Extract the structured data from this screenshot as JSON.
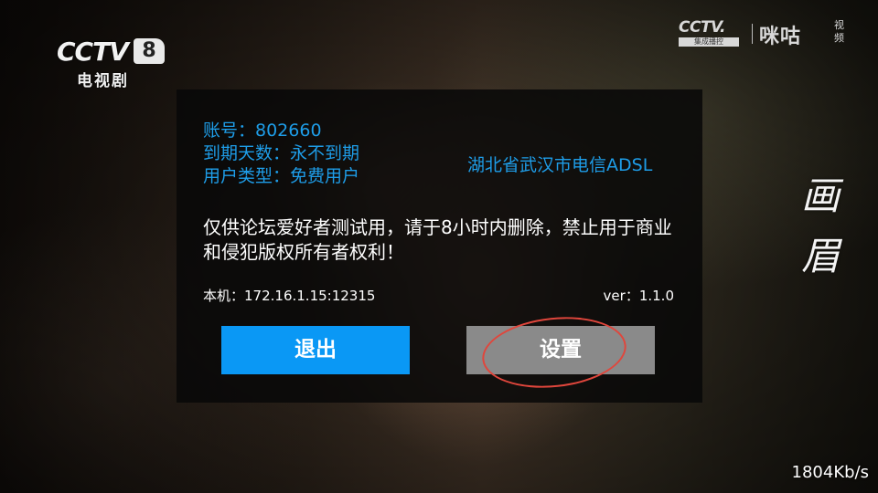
{
  "channel": {
    "logo_word": "CCTV",
    "number": "8",
    "name": "电视剧"
  },
  "partner": {
    "cctv_word": "CCTV.",
    "cctv_sub": "集成播控",
    "migu": "咪咕",
    "migu_sub": "视频"
  },
  "show_title": [
    "画",
    "眉"
  ],
  "dialog": {
    "account": "账号：802660",
    "expiry": "到期天数：永不到期",
    "user_type": "用户类型：免费用户",
    "isp": "湖北省武汉市电信ADSL",
    "notice": "仅供论坛爱好者测试用，请于8小时内删除，禁止用于商业和侵犯版权所有者权利！",
    "local_address": "本机：172.16.1.15:12315",
    "version": "ver：1.1.0",
    "exit_label": "退出",
    "settings_label": "设置"
  },
  "bitrate": "1804Kb/s",
  "colors": {
    "info_text": "#1e9de8",
    "exit_button": "#0a98f5",
    "settings_button": "#8a8a8a",
    "highlight_circle": "#e0463c"
  }
}
